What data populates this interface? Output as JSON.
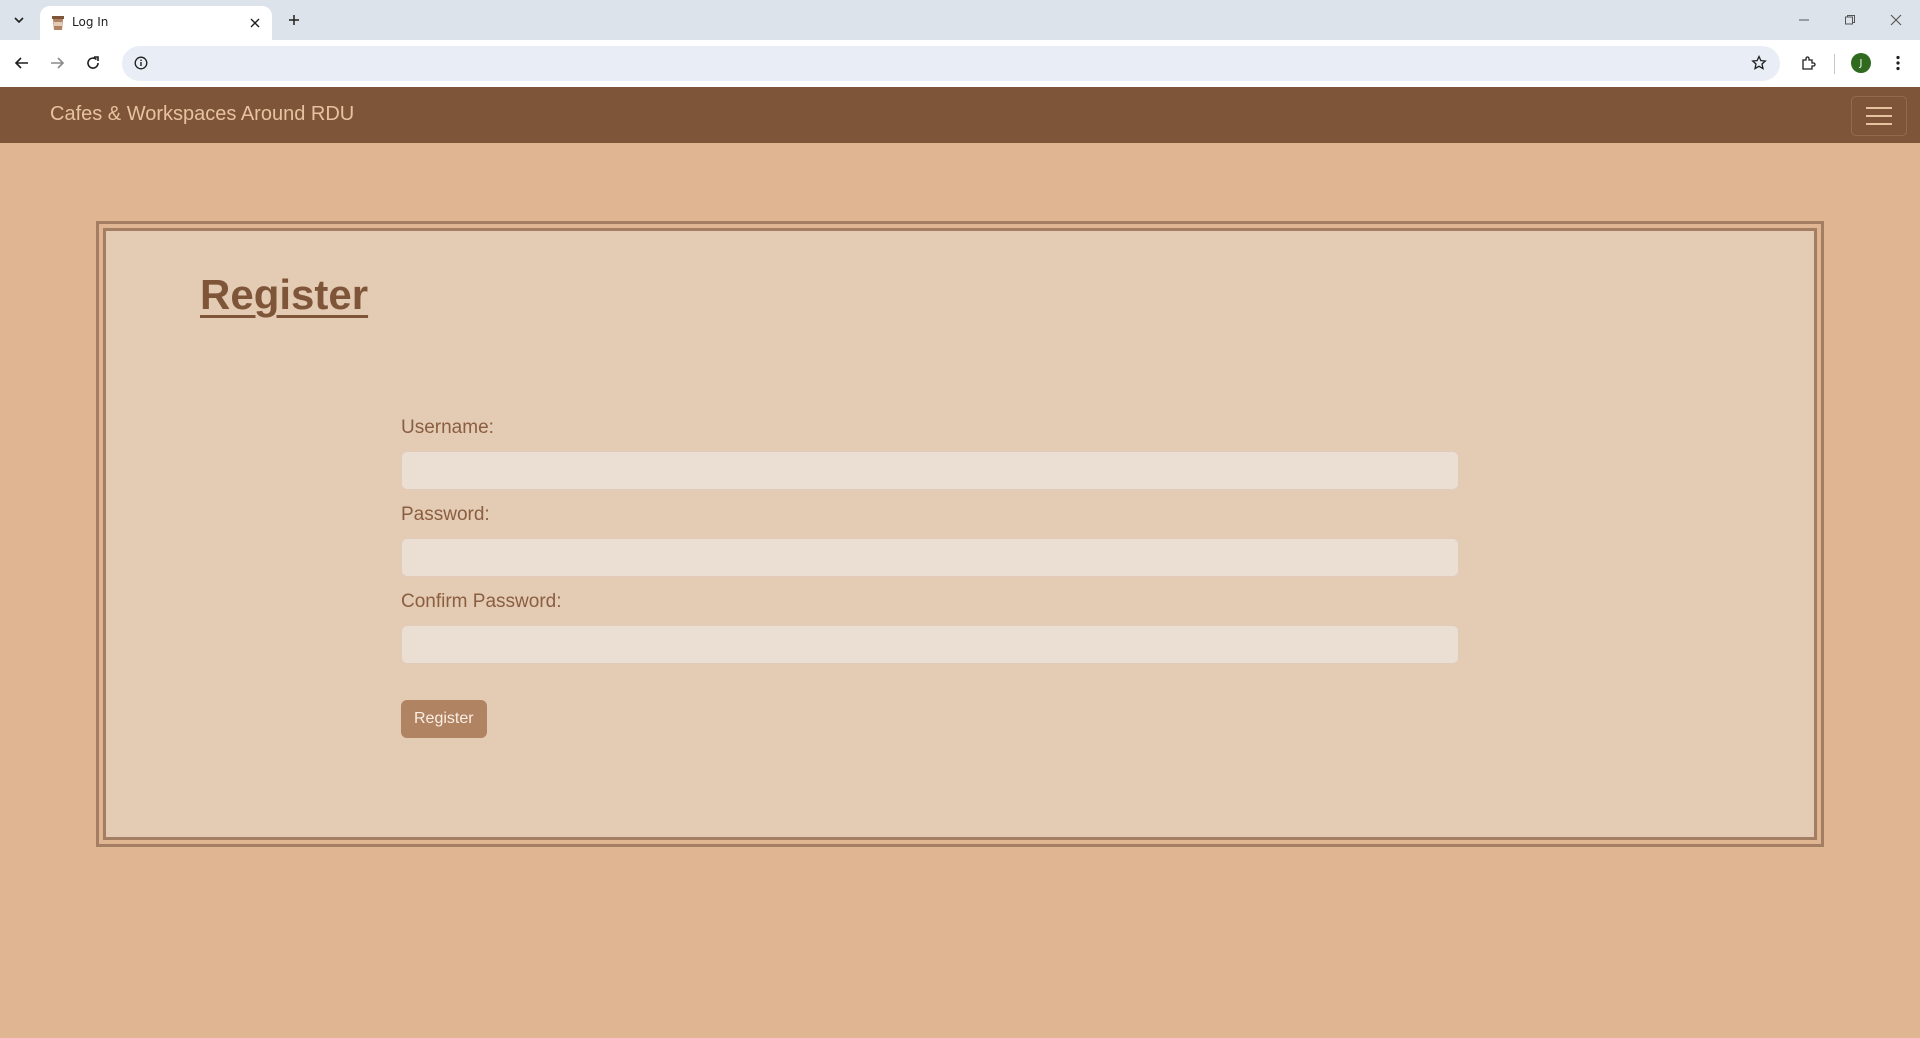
{
  "browser": {
    "tab_title": "Log In",
    "address_value": "",
    "avatar_initial": "J"
  },
  "navbar": {
    "brand": "Cafes & Workspaces Around RDU"
  },
  "page": {
    "title": "Register",
    "form": {
      "username_label": "Username:",
      "username_value": "",
      "password_label": "Password:",
      "password_value": "",
      "confirm_label": "Confirm Password:",
      "confirm_value": "",
      "submit_label": "Register"
    }
  },
  "colors": {
    "navbar_bg": "#7f5539",
    "page_bg": "#dfb592",
    "card_bg": "#e4cbb3",
    "accent_text": "#7f5539",
    "button_bg": "#b08363"
  }
}
